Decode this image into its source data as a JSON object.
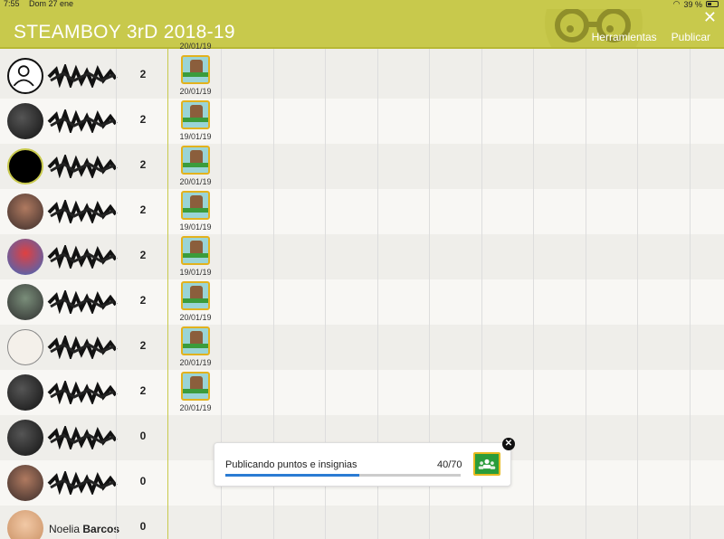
{
  "statusbar": {
    "time": "7:55",
    "date": "Dom 27 ene",
    "battery": "39 %"
  },
  "header": {
    "title": "STEAMBOY 3rD 2018-19",
    "close": "✕",
    "menu": [
      "Herramientas",
      "Publicar"
    ]
  },
  "rows": [
    {
      "name": "",
      "points": "2",
      "date": "20/01/19",
      "badge": true,
      "avatar": "outline"
    },
    {
      "name": "",
      "points": "2",
      "date": "19/01/19",
      "badge": true,
      "avatar": "dark"
    },
    {
      "name": "",
      "points": "2",
      "date": "20/01/19",
      "badge": true,
      "avatar": "black"
    },
    {
      "name": "",
      "points": "2",
      "date": "19/01/19",
      "badge": true,
      "avatar": "photo"
    },
    {
      "name": "",
      "points": "2",
      "date": "19/01/19",
      "badge": true,
      "avatar": "mario"
    },
    {
      "name": "",
      "points": "2",
      "date": "20/01/19",
      "badge": true,
      "avatar": "photo2"
    },
    {
      "name": "",
      "points": "2",
      "date": "20/01/19",
      "badge": true,
      "avatar": "meme"
    },
    {
      "name": "",
      "points": "2",
      "date": "20/01/19",
      "badge": true,
      "avatar": "dark"
    },
    {
      "name": "",
      "points": "0",
      "date": "",
      "badge": false,
      "avatar": "dark"
    },
    {
      "name": "",
      "points": "0",
      "date": "",
      "badge": false,
      "avatar": "photo"
    },
    {
      "name": "Noelia",
      "last": "Barcos",
      "points": "0",
      "date": "",
      "badge": false,
      "avatar": "girl"
    }
  ],
  "toast": {
    "message": "Publicando puntos e insignias",
    "count": "40/70",
    "progress": 0.571
  },
  "colors": {
    "accent": "#c8c94c",
    "progress": "#2b7bd3"
  }
}
